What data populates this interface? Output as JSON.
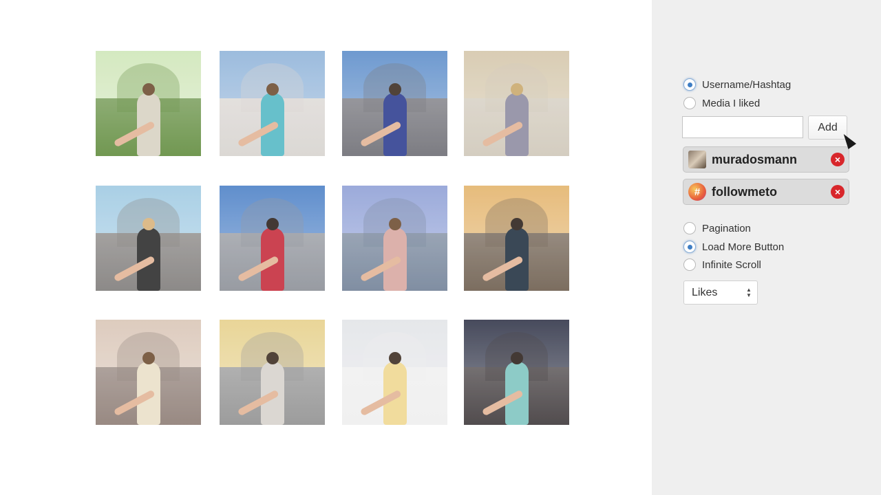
{
  "feed": {
    "photos": [
      {
        "alt": "bamboo-forest-photo",
        "sky": "#cfe6b8",
        "ground": "#5e8a3a",
        "figure": "#d8d2c2",
        "hair": "#6b4a2e"
      },
      {
        "alt": "red-temple-gate-photo",
        "sky": "#8fb3d9",
        "ground": "#d7d3cf",
        "figure": "#53b8c4",
        "hair": "#6b4a2e"
      },
      {
        "alt": "tokyo-street-photo",
        "sky": "#5b8cc9",
        "ground": "#6b6b72",
        "figure": "#2c3c8f",
        "hair": "#3a2a1e"
      },
      {
        "alt": "ornate-corridor-photo",
        "sky": "#d4c6aa",
        "ground": "#cfc7b8",
        "figure": "#8d8aa0",
        "hair": "#c9a86a"
      },
      {
        "alt": "city-rooftop-photo",
        "sky": "#9ec9e2",
        "ground": "#7d7a78",
        "figure": "#2a2a2a",
        "hair": "#d8b27a"
      },
      {
        "alt": "chinese-temple-photo",
        "sky": "#4a7fc6",
        "ground": "#8a8e96",
        "figure": "#c42a3a",
        "hair": "#2a1e18"
      },
      {
        "alt": "skyscraper-photo",
        "sky": "#8e9fd6",
        "ground": "#6f7f96",
        "figure": "#d8a7a0",
        "hair": "#6b4a2e"
      },
      {
        "alt": "market-street-photo",
        "sky": "#e3b36a",
        "ground": "#6a5a4a",
        "figure": "#1f2f3f",
        "hair": "#2a1e18"
      },
      {
        "alt": "dubai-skyline-photo",
        "sky": "#d9c5b6",
        "ground": "#8b7a72",
        "figure": "#eae0c8",
        "hair": "#6b4a2e"
      },
      {
        "alt": "metro-hall-photo",
        "sky": "#e6d08a",
        "ground": "#8f8f8f",
        "figure": "#d7d2cc",
        "hair": "#3a2a1e"
      },
      {
        "alt": "white-palace-photo",
        "sky": "#e2e4e8",
        "ground": "#eeeeee",
        "figure": "#f0d890",
        "hair": "#3a2a1e"
      },
      {
        "alt": "night-palace-photo",
        "sky": "#2e3246",
        "ground": "#3a3436",
        "figure": "#7ec4c0",
        "hair": "#2a1e18"
      }
    ]
  },
  "source": {
    "options": [
      {
        "label": "Username/Hashtag",
        "checked": true
      },
      {
        "label": "Media I liked",
        "checked": false
      }
    ],
    "input_value": "",
    "add_label": "Add",
    "chips": [
      {
        "name": "muradosmann",
        "icon": "user-avatar"
      },
      {
        "name": "followmeto",
        "icon": "hashtag-icon",
        "icon_glyph": "#"
      }
    ],
    "remove_glyph": "×"
  },
  "loading": {
    "options": [
      {
        "label": "Pagination",
        "checked": false
      },
      {
        "label": "Load More Button",
        "checked": true
      },
      {
        "label": "Infinite Scroll",
        "checked": false
      }
    ]
  },
  "sort": {
    "selected": "Likes",
    "arrow_up": "▲",
    "arrow_down": "▼"
  }
}
